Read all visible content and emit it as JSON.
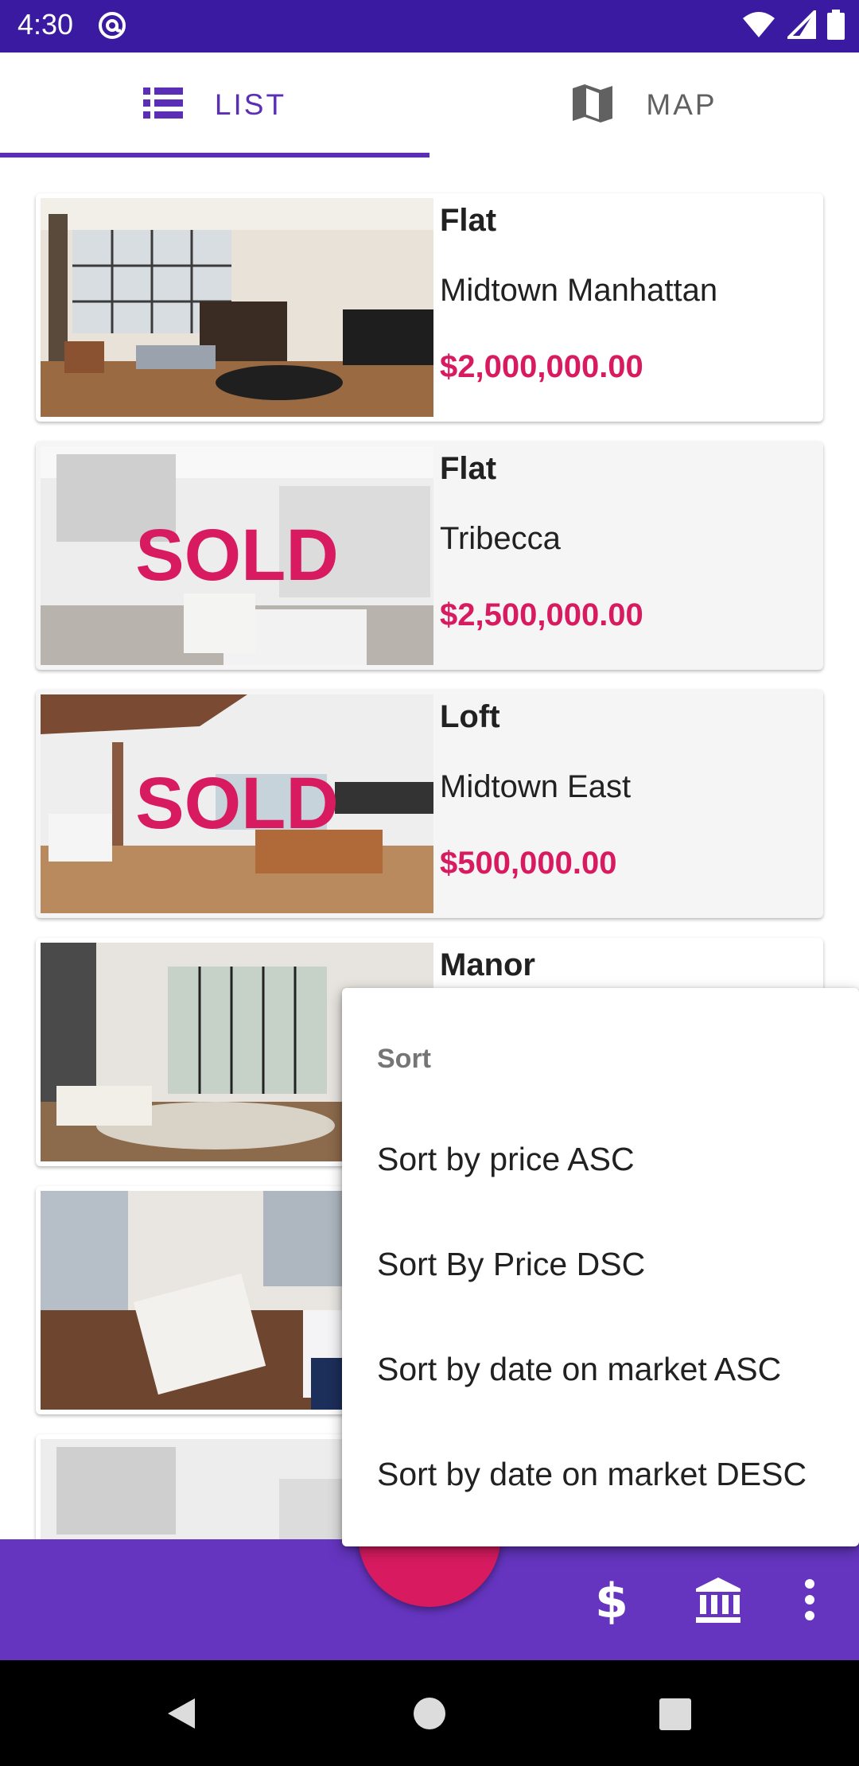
{
  "status_bar": {
    "time": "4:30"
  },
  "tabs": [
    {
      "label": "LIST",
      "icon": "list-icon",
      "selected": true
    },
    {
      "label": "MAP",
      "icon": "map-icon",
      "selected": false
    }
  ],
  "listings": [
    {
      "type": "Flat",
      "area": "Midtown Manhattan",
      "price": "$2,000,000.00",
      "sold": false
    },
    {
      "type": "Flat",
      "area": "Tribecca",
      "price": "$2,500,000.00",
      "sold": true,
      "sold_label": "SOLD"
    },
    {
      "type": "Loft",
      "area": "Midtown East",
      "price": "$500,000.00",
      "sold": true,
      "sold_label": "SOLD"
    },
    {
      "type": "Manor",
      "area": "",
      "price": "",
      "sold": false
    }
  ],
  "sort_menu": {
    "title": "Sort",
    "items": [
      "Sort by price ASC",
      "Sort By Price DSC",
      "Sort by date on market ASC",
      "Sort by date on market DESC"
    ]
  },
  "bottom_bar": {
    "icons": [
      "dollar-icon",
      "bank-icon",
      "more-vert-icon"
    ]
  },
  "colors": {
    "status_bar": "#3a1aa0",
    "primary": "#6535c0",
    "accent": "#d81b60",
    "tab_selected": "#5b2fb5"
  }
}
